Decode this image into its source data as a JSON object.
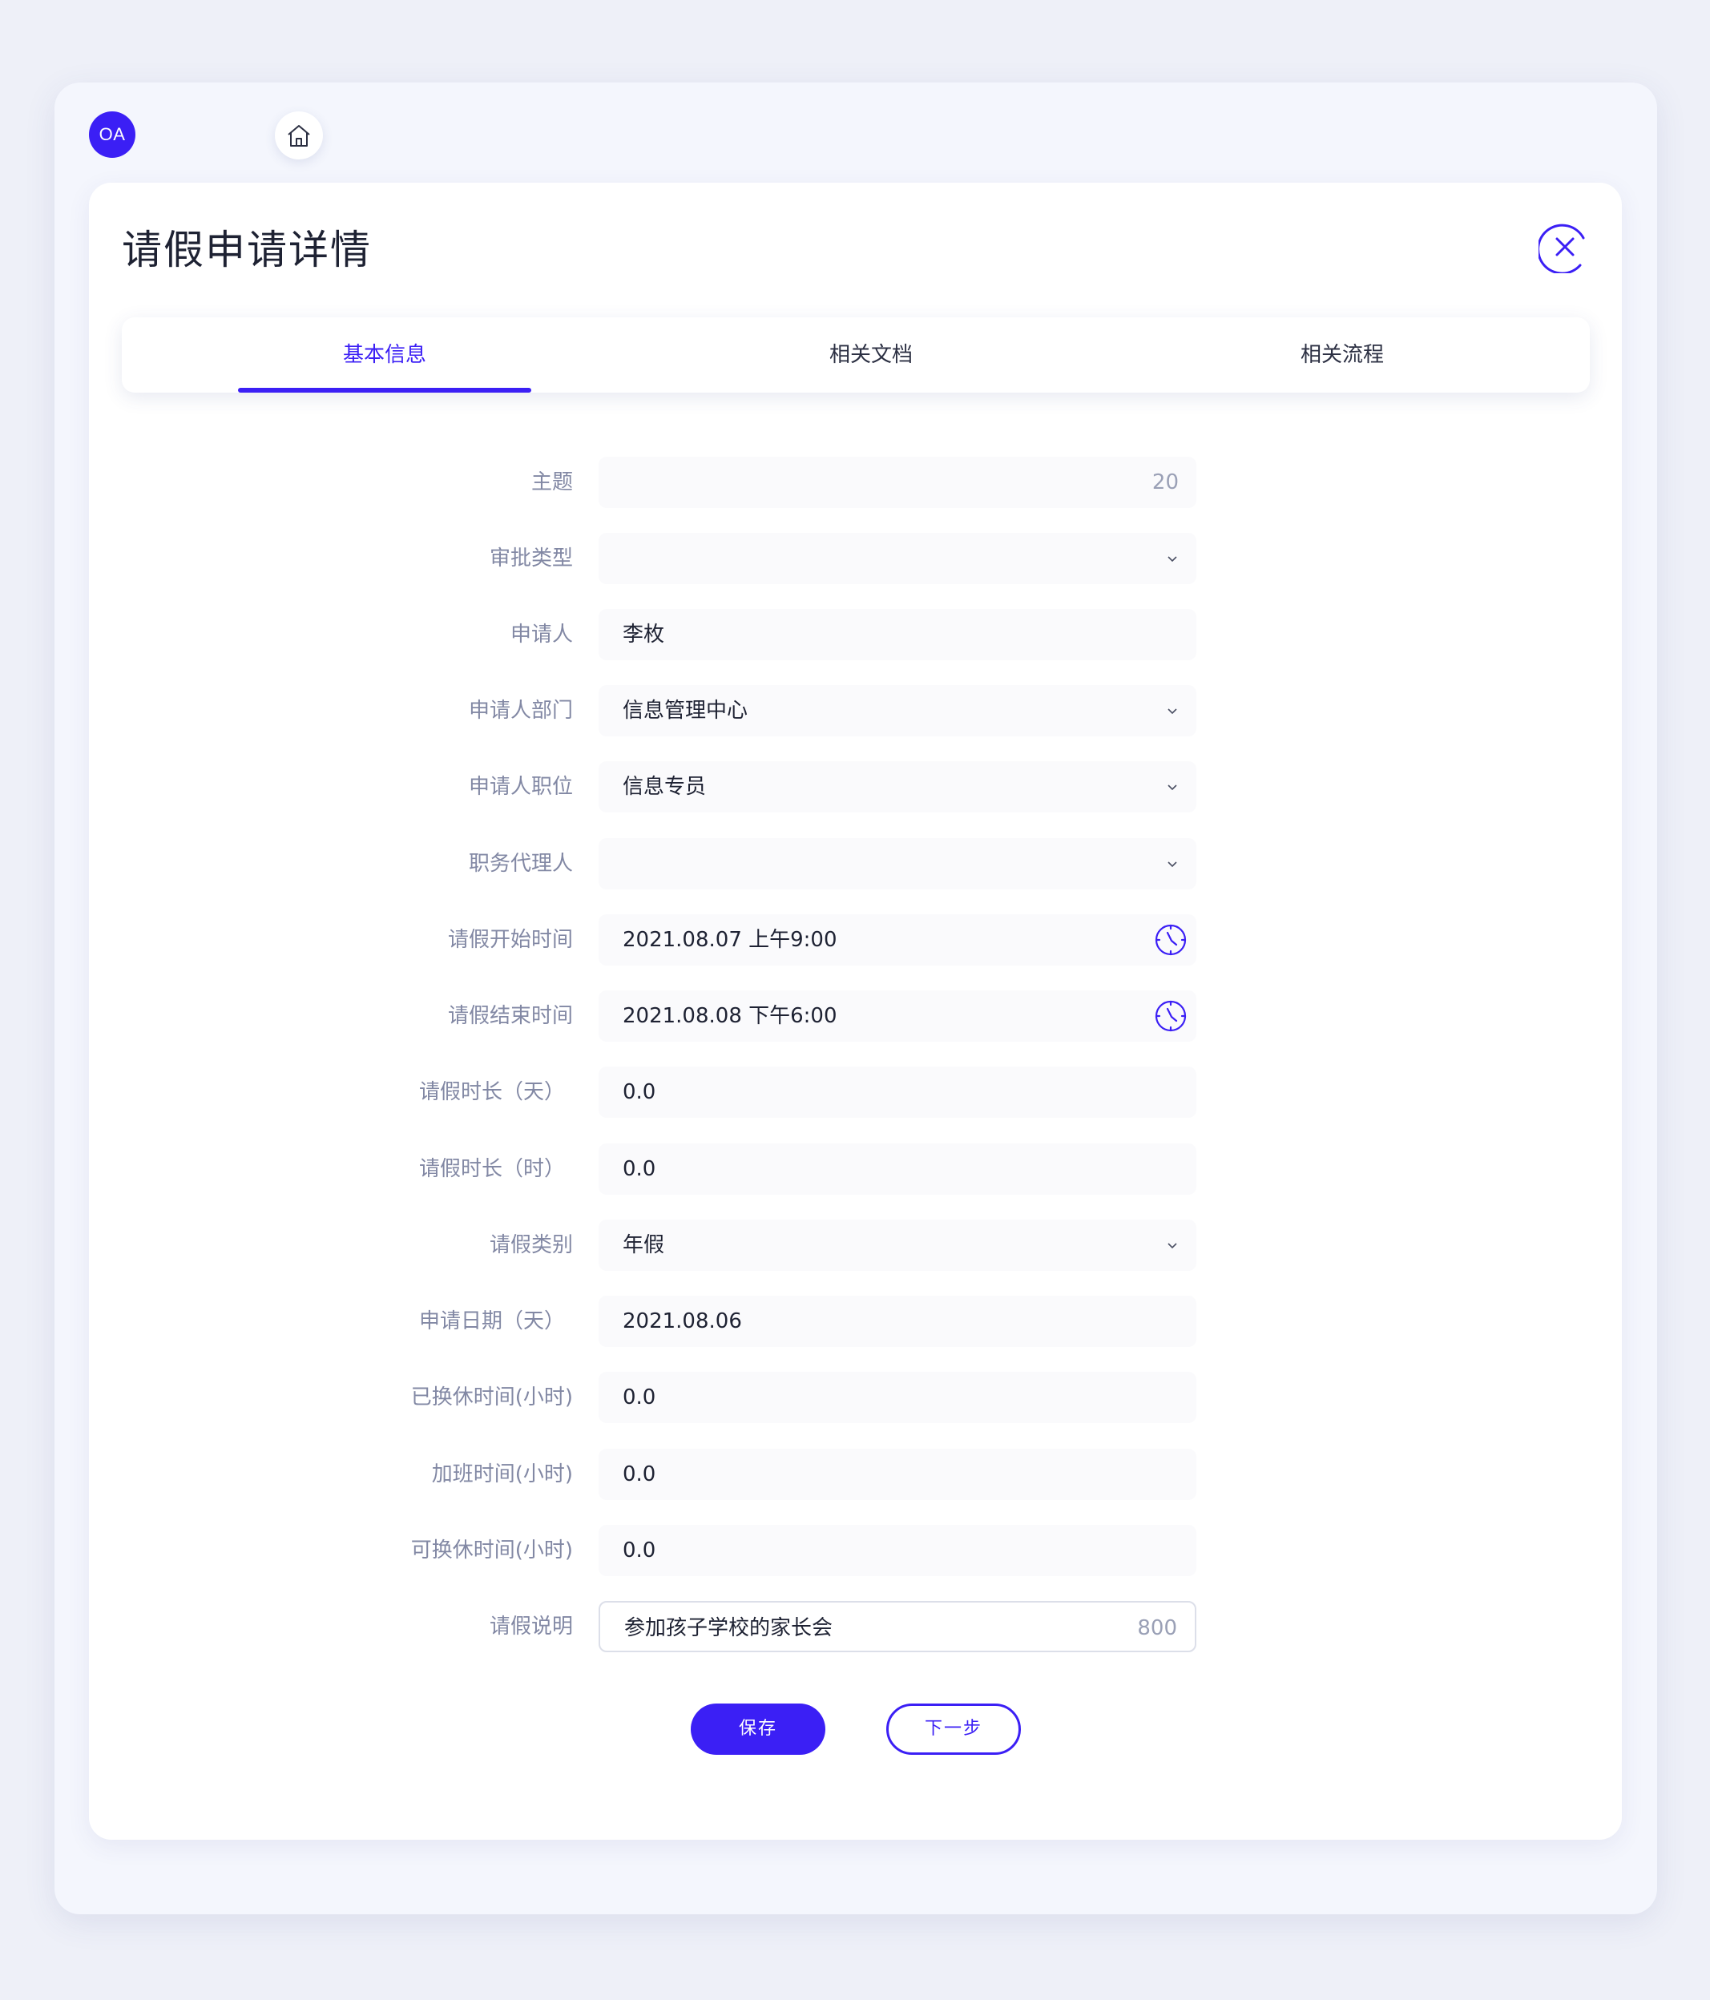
{
  "app": {
    "logo_text": "OA"
  },
  "page": {
    "title": "请假申请详情"
  },
  "colors": {
    "accent": "#3b1ff5",
    "label": "#8288a4",
    "text": "#1e2233"
  },
  "tabs": [
    {
      "label": "基本信息",
      "active": true
    },
    {
      "label": "相关文档",
      "active": false
    },
    {
      "label": "相关流程",
      "active": false
    }
  ],
  "form": {
    "subject": {
      "label": "主题",
      "value": "",
      "counter": "20"
    },
    "approval_type": {
      "label": "审批类型",
      "value": ""
    },
    "applicant": {
      "label": "申请人",
      "value": "李枚"
    },
    "department": {
      "label": "申请人部门",
      "value": "信息管理中心"
    },
    "position": {
      "label": "申请人职位",
      "value": "信息专员"
    },
    "deputy": {
      "label": "职务代理人",
      "value": ""
    },
    "start_time": {
      "label": "请假开始时间",
      "value": "2021.08.07 上午9:00"
    },
    "end_time": {
      "label": "请假结束时间",
      "value": "2021.08.08 下午6:00"
    },
    "duration_days": {
      "label": "请假时长（天）",
      "value": "0.0"
    },
    "duration_hours": {
      "label": "请假时长（时）",
      "value": "0.0"
    },
    "leave_type": {
      "label": "请假类别",
      "value": "年假"
    },
    "apply_date": {
      "label": "申请日期（天）",
      "value": "2021.08.06"
    },
    "swapped_hours": {
      "label": "已换休时间(小时)",
      "value": "0.0"
    },
    "overtime_hours": {
      "label": "加班时间(小时)",
      "value": "0.0"
    },
    "available_hours": {
      "label": "可换休时间(小时)",
      "value": "0.0"
    },
    "description": {
      "label": "请假说明",
      "value": "参加孩子学校的家长会",
      "counter": "800"
    }
  },
  "actions": {
    "save_label": "保存",
    "next_label": "下一步"
  },
  "icons": {
    "home": "home-icon",
    "close": "close-circle-icon",
    "chevron": "chevron-down-icon",
    "clock": "clock-icon"
  }
}
